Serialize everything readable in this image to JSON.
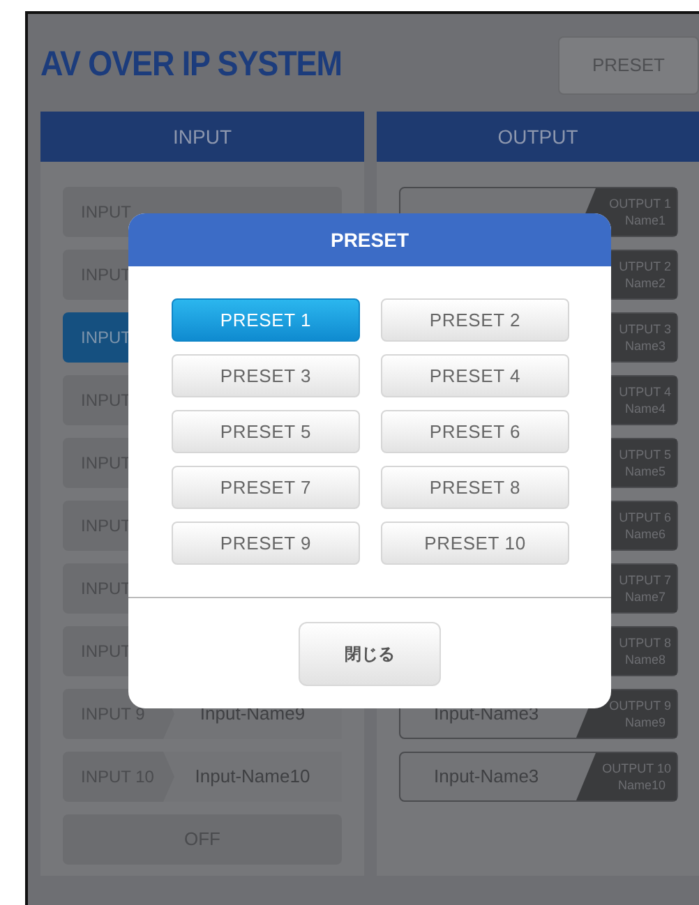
{
  "title": "AV OVER IP SYSTEM",
  "preset_button": "PRESET",
  "input_header": "INPUT",
  "output_header": "OUTPUT",
  "inputs": [
    {
      "label": "INPUT",
      "selected": false
    },
    {
      "label": "INPUT",
      "selected": false
    },
    {
      "label": "INPUT",
      "selected": true
    },
    {
      "label": "INPUT",
      "selected": false
    },
    {
      "label": "INPUT",
      "selected": false
    },
    {
      "label": "INPUT",
      "selected": false
    },
    {
      "label": "INPUT",
      "selected": false
    },
    {
      "label": "INPUT",
      "selected": false
    },
    {
      "label": "INPUT 9",
      "name": "Input-Name9",
      "selected": false
    },
    {
      "label": "INPUT 10",
      "name": "Input-Name10",
      "selected": false
    }
  ],
  "off_button": "OFF",
  "outputs": [
    {
      "label": "OUTPUT 1",
      "sub": "Name1"
    },
    {
      "label": "UTPUT 2",
      "sub": "Name2"
    },
    {
      "label": "UTPUT 3",
      "sub": "Name3"
    },
    {
      "label": "UTPUT 4",
      "sub": "Name4"
    },
    {
      "label": "UTPUT 5",
      "sub": "Name5"
    },
    {
      "label": "UTPUT 6",
      "sub": "Name6"
    },
    {
      "label": "UTPUT 7",
      "sub": "Name7"
    },
    {
      "label": "UTPUT 8",
      "sub": "Name8"
    },
    {
      "label": "OUTPUT 9",
      "sub": "Name9",
      "source": "Input-Name3"
    },
    {
      "label": "OUTPUT 10",
      "sub": "Name10",
      "source": "Input-Name3"
    }
  ],
  "dialog": {
    "title": "PRESET",
    "presets": [
      {
        "label": "PRESET 1",
        "selected": true
      },
      {
        "label": "PRESET 2",
        "selected": false
      },
      {
        "label": "PRESET 3",
        "selected": false
      },
      {
        "label": "PRESET 4",
        "selected": false
      },
      {
        "label": "PRESET 5",
        "selected": false
      },
      {
        "label": "PRESET 6",
        "selected": false
      },
      {
        "label": "PRESET 7",
        "selected": false
      },
      {
        "label": "PRESET 8",
        "selected": false
      },
      {
        "label": "PRESET 9",
        "selected": false
      },
      {
        "label": "PRESET 10",
        "selected": false
      }
    ],
    "close_button": "閉じる"
  }
}
